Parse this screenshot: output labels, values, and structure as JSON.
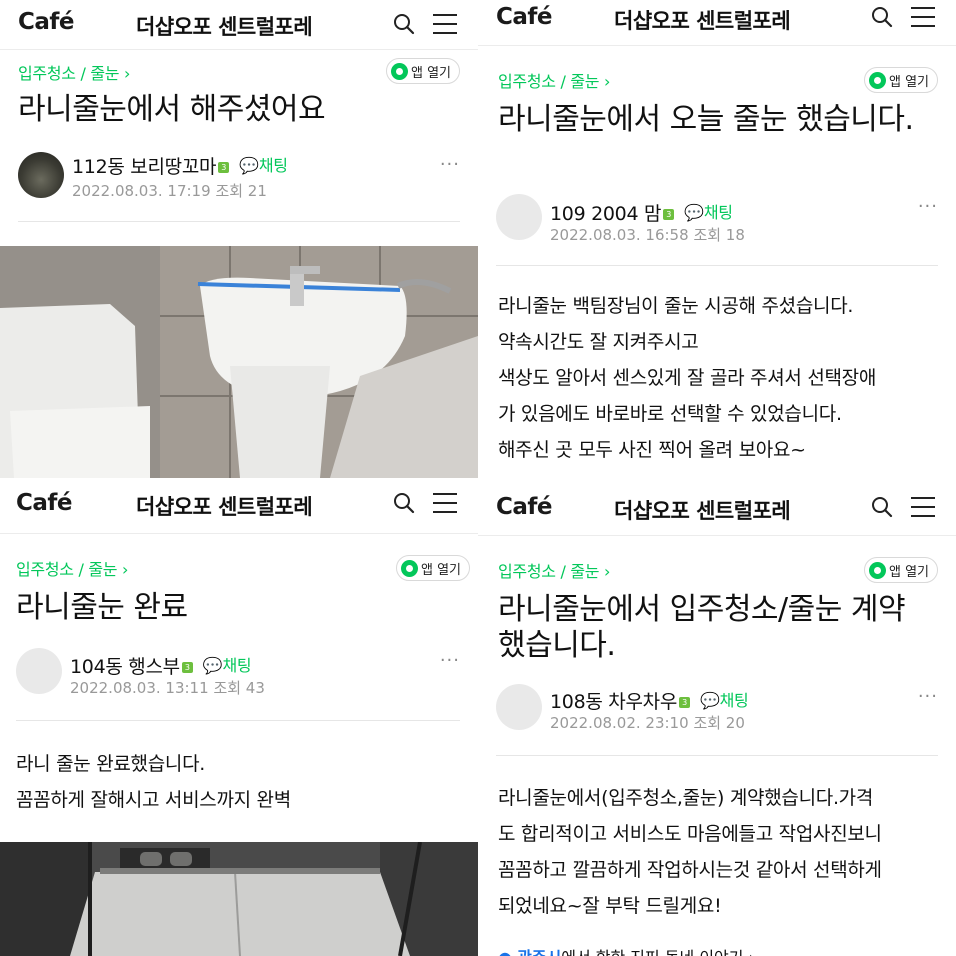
{
  "header": {
    "logo": "Café",
    "cafe_name": "더샵오포 센트럴포레",
    "search_icon": "search-icon",
    "menu_icon": "hamburger-menu-icon"
  },
  "open_app_label": "앱 열기",
  "posts": [
    {
      "breadcrumb": "입주청소 / 줄눈 ›",
      "title": "라니줄눈에서 해주셨어요",
      "author": "112동 보리땅꼬마",
      "level": "3",
      "chat": "채팅",
      "date": "2022.08.03. 17:19",
      "views": "조회 21"
    },
    {
      "breadcrumb": "입주청소 / 줄눈 ›",
      "title": "라니줄눈에서 오늘 줄눈 했습니다.",
      "author": "109 2004 맘",
      "level": "3",
      "chat": "채팅",
      "date": "2022.08.03. 16:58",
      "views": "조회 18",
      "body": [
        "라니줄눈 백팀장님이 줄눈 시공해 주셨습니다.",
        "약속시간도 잘 지켜주시고",
        "색상도 알아서 센스있게 잘 골라 주셔서 선택장애",
        "가 있음에도 바로바로 선택할 수 있었습니다.",
        "해주신 곳 모두 사진 찍어 올려 보아요~"
      ]
    },
    {
      "breadcrumb": "입주청소 / 줄눈 ›",
      "title": "라니줄눈 완료",
      "author": "104동 행스부",
      "level": "3",
      "chat": "채팅",
      "date": "2022.08.03. 13:11",
      "views": "조회 43",
      "body": [
        "라니 줄눈 완료했습니다.",
        "꼼꼼하게 잘해시고 서비스까지 완벽"
      ]
    },
    {
      "breadcrumb": "입주청소 / 줄눈 ›",
      "title": "라니줄눈에서 입주청소/줄눈 계약했습니다.",
      "author": "108동 차우차우",
      "level": "3",
      "chat": "채팅",
      "date": "2022.08.02. 23:10",
      "views": "조회 20",
      "body": [
        "라니줄눈에서(입주청소,줄눈) 계약했습니다.가격",
        "도 합리적이고 서비스도 마음에들고 작업사진보니",
        "꼼꼼하고 깔끔하게 작업하시는것 같아서 선택하게",
        "되었네요~잘 부탁 드릴게요!"
      ],
      "footer_highlight": "광주시",
      "footer_rest": "에서 핫한 지피 동네 이야기 ›"
    }
  ],
  "colors": {
    "accent_green": "#03c75a",
    "meta_gray": "#999999",
    "link_blue": "#1a73e8"
  }
}
